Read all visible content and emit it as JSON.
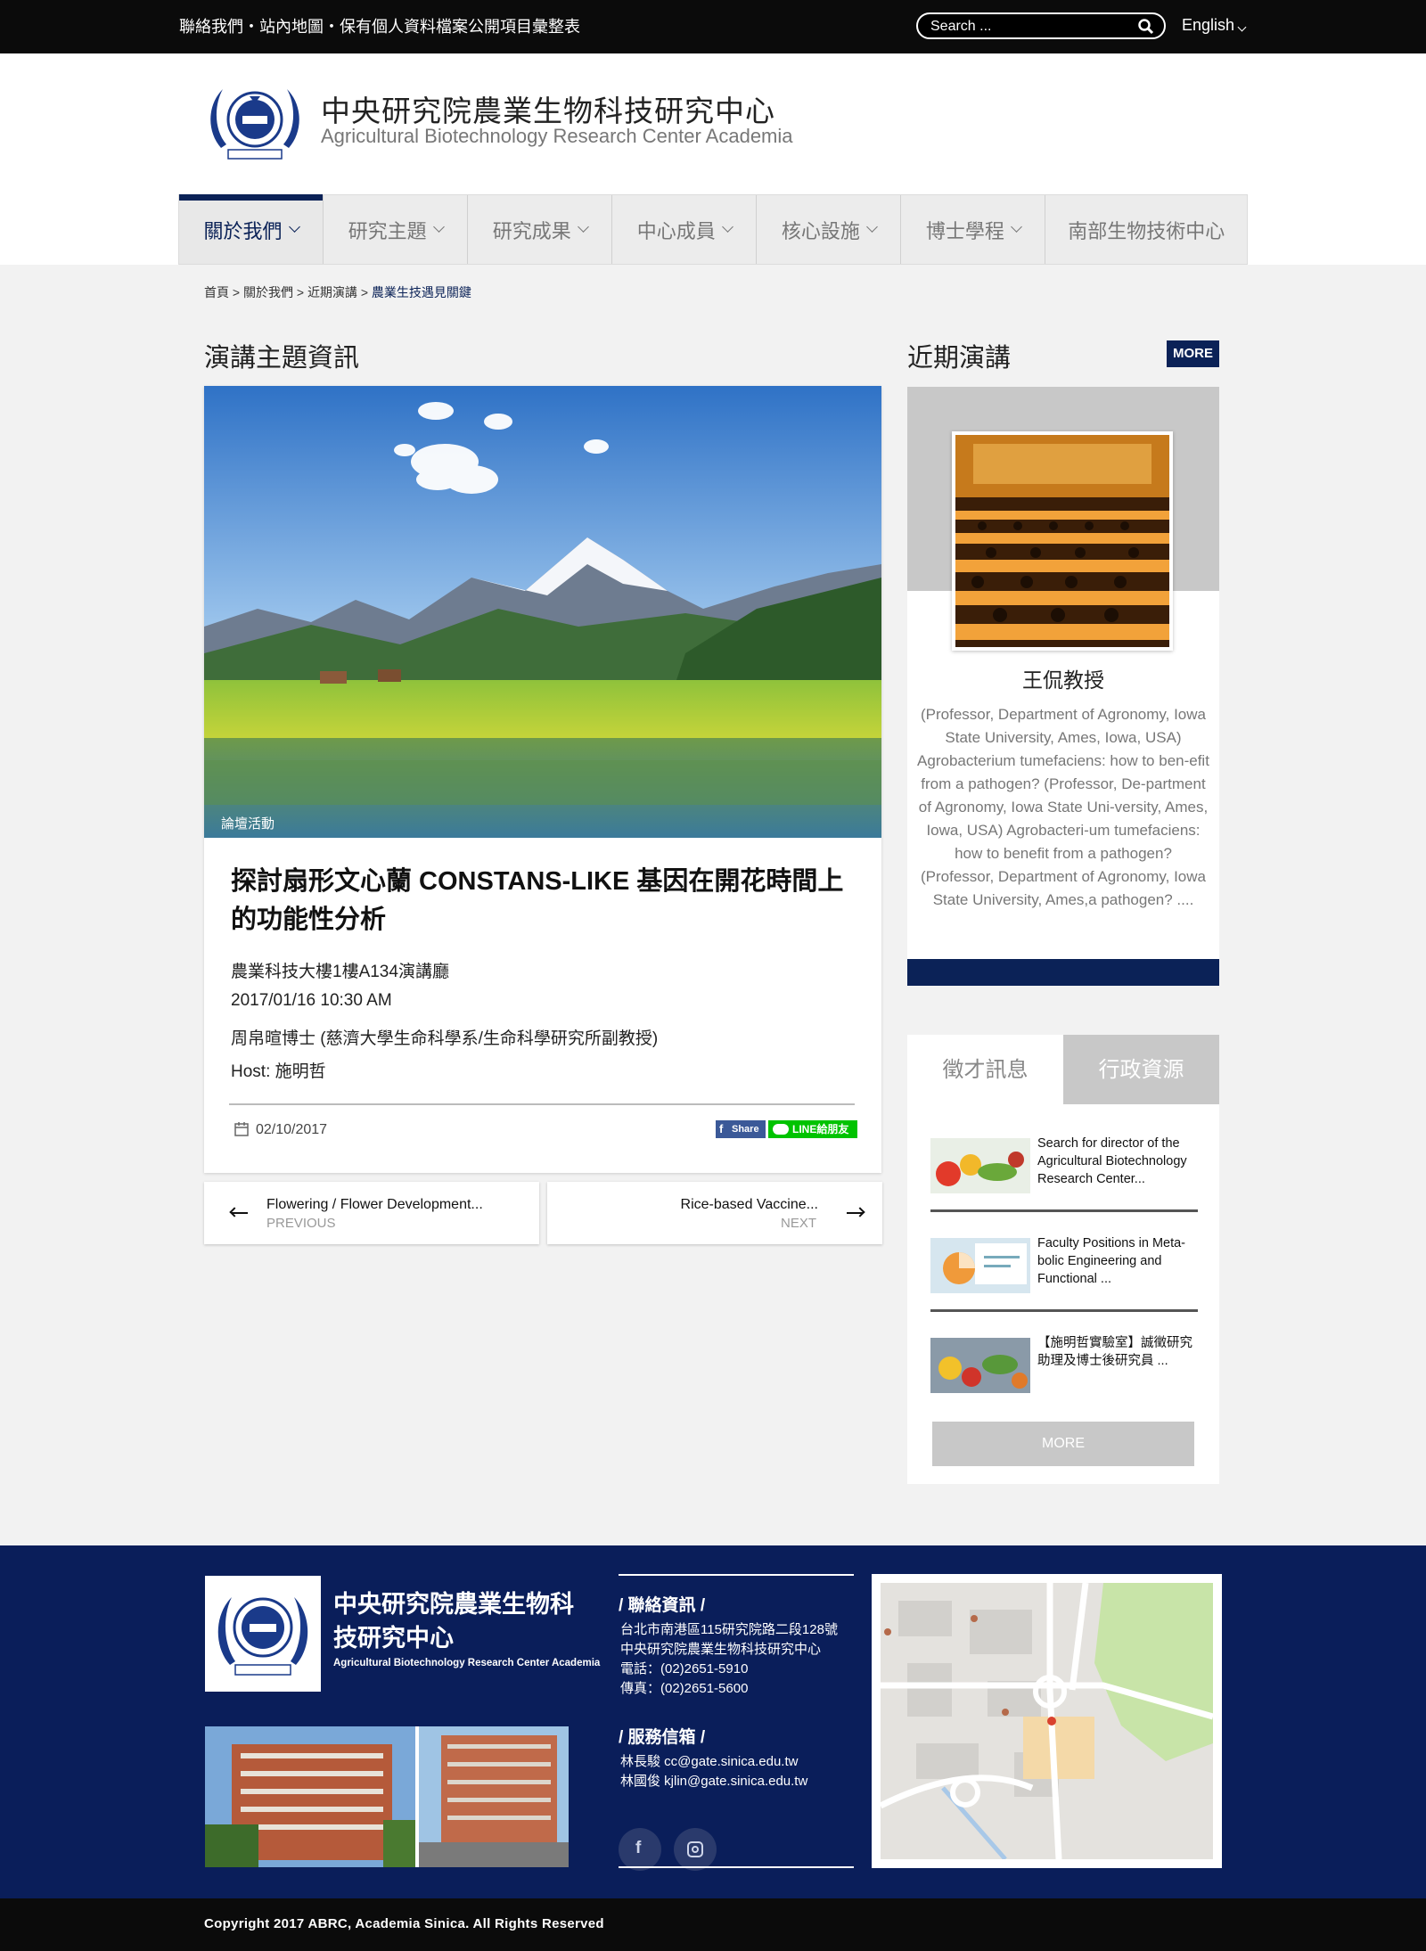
{
  "topbar": {
    "links": "聯絡我們・站內地圖・保有個人資料檔案公開項目彙整表",
    "search_placeholder": "Search ...",
    "language": "English"
  },
  "header": {
    "title_zh": "中央研究院農業生物科技研究中心",
    "title_en": "Agricultural Biotechnology Research Center Academia"
  },
  "nav": {
    "items": [
      {
        "label": "關於我們",
        "active": true
      },
      {
        "label": "研究主題"
      },
      {
        "label": "研究成果"
      },
      {
        "label": "中心成員"
      },
      {
        "label": "核心設施"
      },
      {
        "label": "博士學程"
      },
      {
        "label": "南部生物技術中心"
      }
    ]
  },
  "breadcrumb": {
    "home": "首頁",
    "level1": "關於我們",
    "level2": "近期演講",
    "current": "農業生技遇見關鍵",
    "sep": ">"
  },
  "article": {
    "section_title": "演講主題資訊",
    "category": "論壇活動",
    "title": "探討扇形文心蘭 CONSTANS-LIKE 基因在開花時間上的功能性分析",
    "venue": "農業科技大樓1樓A134演講廳",
    "datetime": "2017/01/16  10:30 AM",
    "speaker": "周帛暄博士 (慈濟大學生命科學系/生命科學研究所副教授)",
    "host": "Host: 施明哲",
    "posted": "02/10/2017",
    "fb_share": "Share",
    "line_share": "LINE給朋友"
  },
  "pager": {
    "prev_title": "Flowering / Flower Development...",
    "prev_label": "PREVIOUS",
    "next_title": "Rice-based Vaccine...",
    "next_label": "NEXT"
  },
  "recent": {
    "title": "近期演講",
    "more": "MORE",
    "name": "王侃教授",
    "desc": "(Professor, Department of Agronomy, Iowa State University, Ames, Iowa, USA) Agrobacterium tumefaciens: how to ben-efit from a pathogen?  (Professor, De-partment of Agronomy, Iowa State Uni-versity, Ames, Iowa, USA) Agrobacteri-um tumefaciens: how to benefit from a pathogen?  (Professor, Department of Agronomy, Iowa State University, Ames,a pathogen? ...."
  },
  "tabs": {
    "tab1": "徵才訊息",
    "tab2": "行政資源",
    "jobs": [
      "Search for director of the Agricultural Biotechnology Research Center...",
      "Faculty Positions in Meta-bolic Engineering and Functional  ...",
      "【施明哲實驗室】誠徵研究助理及博士後研究員 ..."
    ],
    "more": "MORE"
  },
  "footer": {
    "name_zh": "中央研究院農業生物科技研究中心",
    "name_en": "Agricultural Biotechnology Research Center Academia",
    "contact_heading": "/  聯絡資訊  /",
    "address": "台北市南港區115研究院路二段128號",
    "org": "中央研究院農業生物科技研究中心",
    "phone": "電話：(02)2651-5910",
    "fax": "傳真：(02)2651-5600",
    "mail_heading": "/  服務信箱  /",
    "mail1": "林長駿  cc@gate.sinica.edu.tw",
    "mail2": "林國俊  kjlin@gate.sinica.edu.tw"
  },
  "copyright": "Copyright 2017 ABRC, Academia Sinica. All Rights Reserved",
  "colors": {
    "brand_navy": "#0b2257",
    "footer_navy": "#0a1e5a",
    "black_bar": "#0b0b0b",
    "line_green": "#00c300",
    "fb_blue": "#3b5998"
  }
}
